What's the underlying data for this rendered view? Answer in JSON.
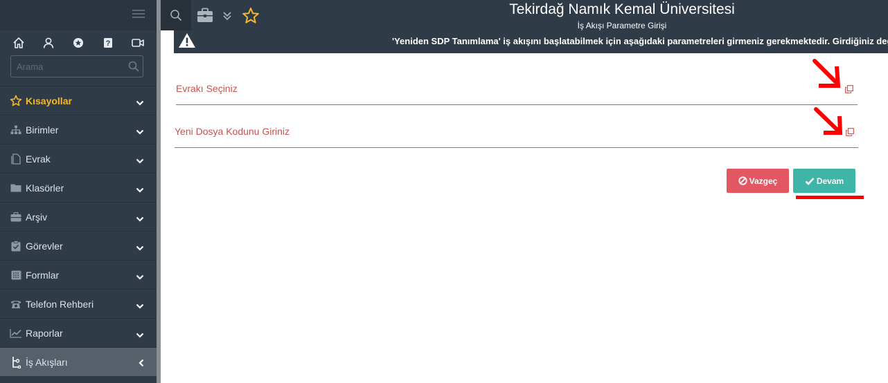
{
  "app": {
    "title": "Tekirdağ Namık Kemal Üniversitesi",
    "subtitle": "İş Akışı Parametre Girişi"
  },
  "sidebar": {
    "search_placeholder": "Arama",
    "top_icons": [
      "home-icon",
      "user-icon",
      "star-circle-icon",
      "help-icon",
      "video-icon"
    ],
    "items": [
      {
        "label": "Kısayollar",
        "icon": "star-icon",
        "expanded": false
      },
      {
        "label": "Birimler",
        "icon": "sitemap-icon",
        "expanded": false
      },
      {
        "label": "Evrak",
        "icon": "document-icon",
        "expanded": false
      },
      {
        "label": "Klasörler",
        "icon": "folder-icon",
        "expanded": false
      },
      {
        "label": "Arşiv",
        "icon": "archive-icon",
        "expanded": false
      },
      {
        "label": "Görevler",
        "icon": "clipboard-icon",
        "expanded": false
      },
      {
        "label": "Formlar",
        "icon": "form-icon",
        "expanded": false
      },
      {
        "label": "Telefon Rehberi",
        "icon": "phone-icon",
        "expanded": false
      },
      {
        "label": "Raporlar",
        "icon": "chart-icon",
        "expanded": false
      },
      {
        "label": "İş Akışları",
        "icon": "workflow-icon",
        "expanded": true
      }
    ]
  },
  "banner": {
    "text": "'Yeniden SDP Tanımlama' iş akışını başlatabilmek için aşağıdaki parametreleri girmeniz gerekmektedir. Girdiğiniz değerler"
  },
  "form": {
    "fields": [
      {
        "label": "Evrakı Seçiniz"
      },
      {
        "label": "Yeni Dosya Kodunu Giriniz"
      }
    ],
    "cancel_label": "Vazgeç",
    "continue_label": "Devam"
  },
  "colors": {
    "sidebar_bg": "#2f3b47",
    "accent_yellow": "#f5b82e",
    "field_red": "#d9534f",
    "cancel_red": "#e25762",
    "continue_teal": "#3fb5a8",
    "annotation_red": "#ff0000"
  }
}
